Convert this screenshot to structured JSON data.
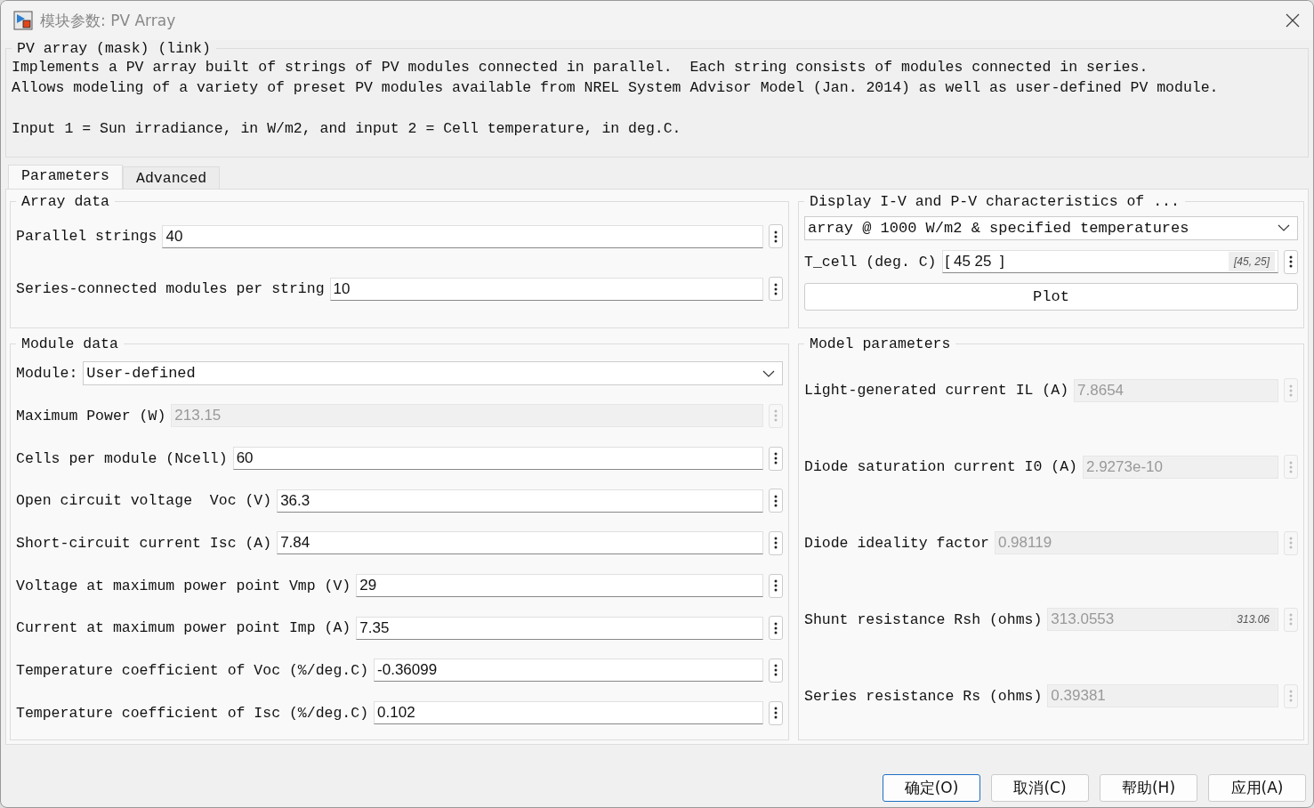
{
  "window": {
    "title": "模块参数: PV Array"
  },
  "description": {
    "title": "PV array (mask) (link)",
    "paragraphs": [
      [
        "Implements a PV array built of strings of PV modules connected in parallel.  Each string consists of modules connected in series.",
        "Allows modeling of a variety of preset PV modules available from NREL System Advisor Model (Jan. 2014) as well as user-defined PV module."
      ],
      [
        "Input 1 = Sun irradiance, in W/m2, and input 2 = Cell temperature, in deg.C."
      ]
    ]
  },
  "tabs": [
    {
      "label": "Parameters",
      "selected": true
    },
    {
      "label": "Advanced",
      "selected": false
    }
  ],
  "left_groups": [
    {
      "title": "Array data",
      "items": [
        {
          "kind": "field",
          "label": "Parallel strings",
          "value": "40",
          "disabled": false
        },
        {
          "kind": "field",
          "label": "Series-connected modules per string",
          "value": "10",
          "disabled": false
        }
      ]
    },
    {
      "title": "Module data",
      "items": [
        {
          "kind": "dropdown",
          "label": "Module:",
          "value": "User-defined"
        },
        {
          "kind": "field",
          "label": "Maximum Power (W)",
          "value": "213.15",
          "disabled": true
        },
        {
          "kind": "field",
          "label": "Cells per module (Ncell)",
          "value": "60",
          "disabled": false
        },
        {
          "kind": "field",
          "label": "Open circuit voltage  Voc (V)",
          "value": "36.3",
          "disabled": false
        },
        {
          "kind": "field",
          "label": "Short-circuit current Isc (A)",
          "value": "7.84",
          "disabled": false
        },
        {
          "kind": "field",
          "label": "Voltage at maximum power point Vmp (V)",
          "value": "29",
          "disabled": false
        },
        {
          "kind": "field",
          "label": "Current at maximum power point Imp (A)",
          "value": "7.35",
          "disabled": false
        },
        {
          "kind": "field",
          "label": "Temperature coefficient of Voc (%/deg.C)",
          "value": "-0.36099",
          "disabled": false
        },
        {
          "kind": "field",
          "label": "Temperature coefficient of Isc (%/deg.C)",
          "value": "0.102",
          "disabled": false
        }
      ]
    }
  ],
  "right_groups": [
    {
      "title": "Display  I-V and P-V characteristics of ...",
      "items": [
        {
          "kind": "dropdown",
          "value": "array @ 1000 W/m2 & specified temperatures"
        },
        {
          "kind": "field",
          "label": "T_cell (deg. C)",
          "value": "[ 45 25  ]",
          "hint": "[45, 25]",
          "disabled": false
        },
        {
          "kind": "button",
          "label": "Plot"
        }
      ]
    },
    {
      "title": "Model parameters",
      "items": [
        {
          "kind": "field",
          "label": "Light-generated current IL (A)",
          "value": "7.8654",
          "disabled": true
        },
        {
          "kind": "field",
          "label": "Diode saturation current I0 (A)",
          "value": "2.9273e-10",
          "disabled": true
        },
        {
          "kind": "field",
          "label": "Diode ideality factor",
          "value": "0.98119",
          "disabled": true
        },
        {
          "kind": "field",
          "label": "Shunt resistance Rsh (ohms)",
          "value": "313.0553",
          "hint": "313.06",
          "disabled": true
        },
        {
          "kind": "field",
          "label": "Series resistance Rs (ohms)",
          "value": "0.39381",
          "disabled": true
        }
      ]
    }
  ],
  "buttons": [
    {
      "label": "确定(O)",
      "default": true
    },
    {
      "label": "取消(C)",
      "default": false
    },
    {
      "label": "帮助(H)",
      "default": false
    },
    {
      "label": "应用(A)",
      "default": false
    }
  ]
}
